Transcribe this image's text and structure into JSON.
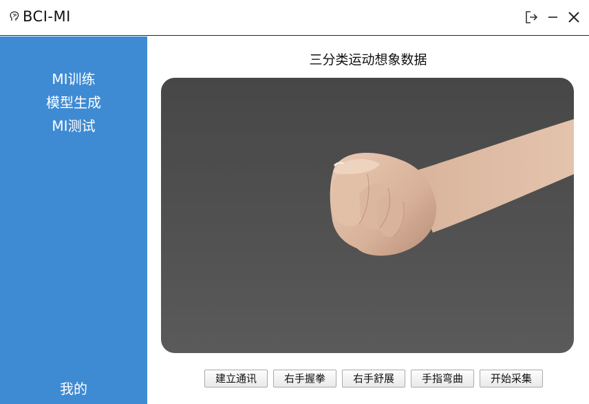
{
  "window": {
    "title": "BCI-MI",
    "logo_icon": "brain-icon",
    "controls": [
      "logout-icon",
      "minimize-icon",
      "close-icon"
    ]
  },
  "sidebar": {
    "items": [
      {
        "label": "MI训练"
      },
      {
        "label": "模型生成"
      },
      {
        "label": "MI测试"
      }
    ],
    "bottom_item": {
      "label": "我的"
    },
    "color": "#3f8bd3"
  },
  "main": {
    "title": "三分类运动想象数据",
    "media": {
      "icon": "clenched-fist-image"
    },
    "buttons": [
      {
        "label": "建立通讯"
      },
      {
        "label": "右手握拳"
      },
      {
        "label": "右手舒展"
      },
      {
        "label": "手指弯曲"
      },
      {
        "label": "开始采集"
      }
    ]
  }
}
